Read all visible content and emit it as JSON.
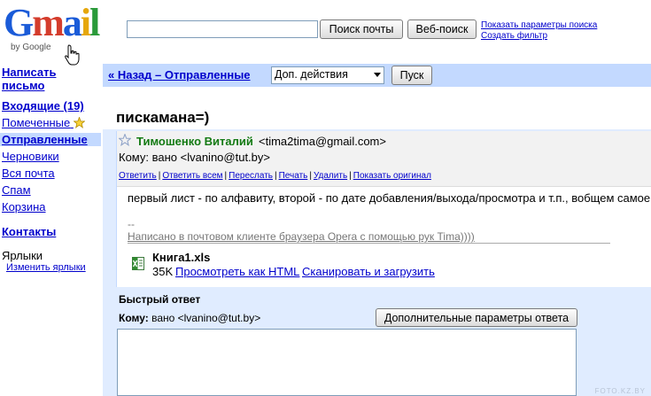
{
  "logo": {
    "letters": [
      "G",
      "m",
      "a",
      "i",
      "l",
      ""
    ],
    "byline": "by Google"
  },
  "header": {
    "search_value": "",
    "search_mail_label": "Поиск почты",
    "web_search_label": "Веб-поиск",
    "search_options_link": "Показать параметры поиска",
    "create_filter_link": "Создать фильтр"
  },
  "sidebar": {
    "compose_line1": "Написать",
    "compose_line2": "письмо",
    "inbox": "Входящие (19)",
    "starred": "Помеченные",
    "sent": "Отправленные",
    "drafts": "Черновики",
    "all_mail": "Вся почта",
    "spam": "Спам",
    "trash": "Корзина",
    "contacts": "Контакты",
    "labels_title": "Ярлыки",
    "edit_labels": "Изменить ярлыки"
  },
  "toolbar": {
    "back_link": "« Назад – Отправленные",
    "actions_select": "Доп. действия",
    "go_button": "Пуск"
  },
  "message": {
    "subject": "пискамана=)",
    "sender_name": "Тимошенко Виталий",
    "sender_email": "<tima2tima@gmail.com>",
    "to_line": "Кому: вано <lvanino@tut.by>",
    "actions": [
      "Ответить",
      "Ответить всем",
      "Переслать",
      "Печать",
      "Удалить",
      "Показать оригинал"
    ],
    "body": "первый лист - по алфавиту, второй - по дате добавления/выхода/просмотра и т.п., вобщем самое",
    "sig_dashes": "--",
    "signature": "Написано в почтовом клиенте браузера Opera с помощью рук Tima))))",
    "attachment": {
      "name": "Книга1.xls",
      "size": "35K",
      "view_html": "Просмотреть как HTML",
      "scan_download": "Сканировать и загрузить"
    }
  },
  "quick_reply": {
    "title": "Быстрый ответ",
    "to_label": "Кому:",
    "to_value": "вано <lvanino@tut.by>",
    "more_options": "Дополнительные параметры ответа"
  },
  "watermark": "FOTO.KZ.BY",
  "colors": {
    "nav_highlight": "#c3d9ff",
    "frame": "#e0ecff",
    "link": "#0000cc",
    "sender": "#137a13"
  }
}
